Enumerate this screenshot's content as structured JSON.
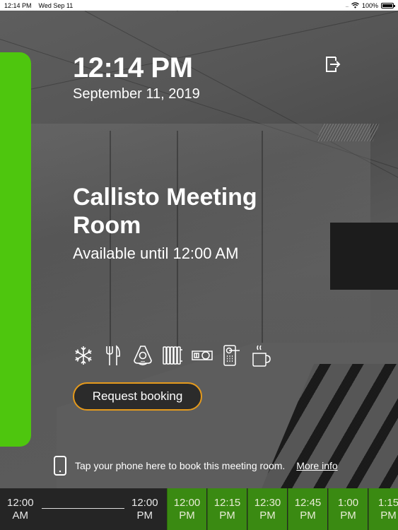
{
  "status_bar": {
    "time": "12:14 PM",
    "date": "Wed Sep 11",
    "battery": "100%"
  },
  "header": {
    "clock": "12:14 PM",
    "date": "September 11, 2019",
    "logout_icon": "logout-icon"
  },
  "room": {
    "name": "Callisto Meeting Room",
    "availability": "Available until 12:00 AM",
    "status_color": "#4ec60e"
  },
  "amenities": [
    {
      "icon": "air-conditioning-icon",
      "label": "Air conditioning"
    },
    {
      "icon": "catering-icon",
      "label": "Catering"
    },
    {
      "icon": "conference-phone-icon",
      "label": "Conference phone"
    },
    {
      "icon": "heating-icon",
      "label": "Heating"
    },
    {
      "icon": "projector-icon",
      "label": "Projector"
    },
    {
      "icon": "door-lock-icon",
      "label": "Access control"
    },
    {
      "icon": "coffee-icon",
      "label": "Coffee"
    }
  ],
  "actions": {
    "request_booking": "Request booking",
    "accent_color": "#e59a1c"
  },
  "nfc": {
    "text": "Tap your phone here to book this meeting room.",
    "link": "More info"
  },
  "timeline": {
    "past_start": {
      "time": "12:00",
      "period": "AM"
    },
    "past_end": {
      "time": "12:00",
      "period": "PM"
    },
    "slots": [
      {
        "time": "12:00",
        "period": "PM"
      },
      {
        "time": "12:15",
        "period": "PM"
      },
      {
        "time": "12:30",
        "period": "PM"
      },
      {
        "time": "12:45",
        "period": "PM"
      },
      {
        "time": "1:00",
        "period": "PM"
      },
      {
        "time": "1:15",
        "period": "PM"
      }
    ],
    "available_color": "#3a8a12"
  }
}
